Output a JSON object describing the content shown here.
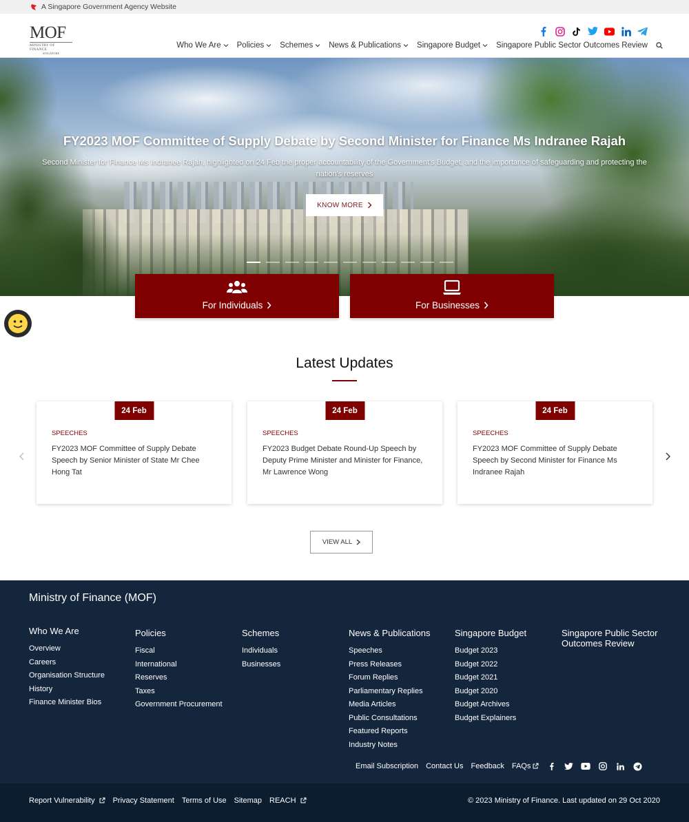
{
  "masthead": {
    "text": "A Singapore Government Agency Website"
  },
  "header": {
    "logo_main": "MOF",
    "logo_sub": "MINISTRY OF FINANCE",
    "logo_country": "SINGAPORE",
    "socials": [
      "facebook-icon",
      "instagram-icon",
      "tiktok-icon",
      "twitter-icon",
      "youtube-icon",
      "linkedin-icon",
      "telegram-icon"
    ],
    "nav": [
      {
        "label": "Who We Are"
      },
      {
        "label": "Policies"
      },
      {
        "label": "Schemes"
      },
      {
        "label": "News & Publications"
      },
      {
        "label": "Singapore Budget"
      },
      {
        "label": "Singapore Public Sector Outcomes Review"
      }
    ]
  },
  "hero": {
    "title": "FY2023 MOF Committee of Supply Debate by Second Minister for Finance Ms Indranee Rajah",
    "description": "Second Minister for Finance Ms Indranee Rajah, highlighted on 24 Feb the proper accountability of the Government's  Budget, and the importance of safeguarding and protecting the nation's reserves",
    "button": "KNOW MORE"
  },
  "cta": {
    "individuals": "For Individuals",
    "businesses": "For Businesses"
  },
  "latest": {
    "title": "Latest Updates",
    "cards": [
      {
        "date": "24 Feb",
        "category": "SPEECHES",
        "title": "FY2023 MOF Committee of Supply Debate Speech by Senior Minister of State Mr Chee Hong Tat"
      },
      {
        "date": "24 Feb",
        "category": "SPEECHES",
        "title": "FY2023 Budget Debate Round-Up Speech by Deputy Prime Minister and Minister for Finance, Mr Lawrence Wong"
      },
      {
        "date": "24 Feb",
        "category": "SPEECHES",
        "title": "FY2023 MOF Committee of Supply Debate Speech by Second Minister for Finance Ms Indranee Rajah"
      }
    ],
    "view_all": "VIEW ALL"
  },
  "footer": {
    "title": "Ministry of Finance (MOF)",
    "columns": [
      {
        "heading": "Who We Are",
        "links": [
          "Overview",
          "Careers",
          "Organisation Structure",
          "History",
          "Finance Minister Bios"
        ]
      },
      {
        "heading": "Policies",
        "links": [
          "Fiscal",
          "International",
          "Reserves",
          "Taxes",
          "Government Procurement"
        ]
      },
      {
        "heading": "Schemes",
        "links": [
          "Individuals",
          "Businesses"
        ]
      },
      {
        "heading": "News & Publications",
        "links": [
          "Speeches",
          "Press Releases",
          "Forum Replies",
          "Parliamentary Replies",
          "Media Articles",
          "Public Consultations",
          "Featured Reports",
          "Industry Notes"
        ]
      },
      {
        "heading": "Singapore Budget",
        "links": [
          "Budget 2023",
          "Budget 2022",
          "Budget 2021",
          "Budget 2020",
          "Budget Archives",
          "Budget Explainers"
        ]
      },
      {
        "heading": "Singapore Public Sector Outcomes Review",
        "links": []
      }
    ],
    "utility_links": [
      "Email Subscription",
      "Contact Us",
      "Feedback",
      "FAQs"
    ],
    "bottom_links": [
      "Report Vulnerability",
      "Privacy Statement",
      "Terms of Use",
      "Sitemap",
      "REACH"
    ],
    "copyright": "© 2023 Ministry of Finance. Last updated on 29 Oct 2020"
  },
  "colors": {
    "brand": "#7f0000",
    "footer_bg": "#13263c",
    "footer_bottom": "#0c1d30"
  }
}
